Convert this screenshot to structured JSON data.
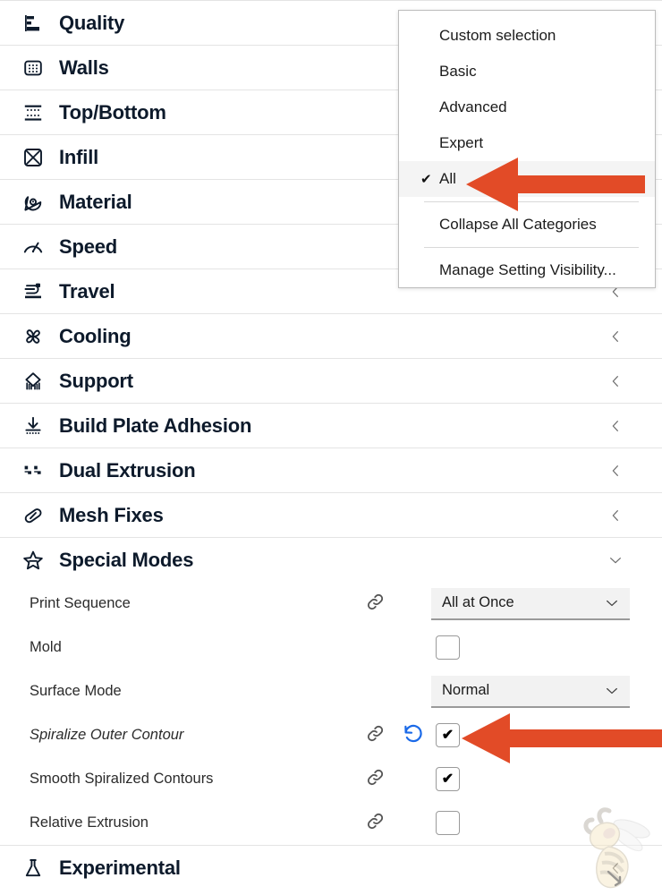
{
  "categories": [
    {
      "label": "Quality",
      "icon": "quality-icon",
      "expanded": false
    },
    {
      "label": "Walls",
      "icon": "walls-icon",
      "expanded": false
    },
    {
      "label": "Top/Bottom",
      "icon": "top-bottom-icon",
      "expanded": false
    },
    {
      "label": "Infill",
      "icon": "infill-icon",
      "expanded": false
    },
    {
      "label": "Material",
      "icon": "material-icon",
      "expanded": false
    },
    {
      "label": "Speed",
      "icon": "speed-icon",
      "expanded": false
    },
    {
      "label": "Travel",
      "icon": "travel-icon",
      "expanded": false
    },
    {
      "label": "Cooling",
      "icon": "cooling-icon",
      "expanded": false
    },
    {
      "label": "Support",
      "icon": "support-icon",
      "expanded": false
    },
    {
      "label": "Build Plate Adhesion",
      "icon": "adhesion-icon",
      "expanded": false
    },
    {
      "label": "Dual Extrusion",
      "icon": "dual-extrusion-icon",
      "expanded": false
    },
    {
      "label": "Mesh Fixes",
      "icon": "mesh-fixes-icon",
      "expanded": false
    },
    {
      "label": "Special Modes",
      "icon": "special-modes-icon",
      "expanded": true
    },
    {
      "label": "Experimental",
      "icon": "experimental-icon",
      "expanded": false
    }
  ],
  "settings": [
    {
      "label": "Print Sequence",
      "italic": false,
      "link": true,
      "revert": false,
      "control": "combo",
      "value": "All at Once"
    },
    {
      "label": "Mold",
      "italic": false,
      "link": false,
      "revert": false,
      "control": "checkbox",
      "checked": false
    },
    {
      "label": "Surface Mode",
      "italic": false,
      "link": false,
      "revert": false,
      "control": "combo",
      "value": "Normal"
    },
    {
      "label": "Spiralize Outer Contour",
      "italic": true,
      "link": true,
      "revert": true,
      "control": "checkbox",
      "checked": true
    },
    {
      "label": "Smooth Spiralized Contours",
      "italic": false,
      "link": true,
      "revert": false,
      "control": "checkbox",
      "checked": true
    },
    {
      "label": "Relative Extrusion",
      "italic": false,
      "link": true,
      "revert": false,
      "control": "checkbox",
      "checked": false
    }
  ],
  "menu": {
    "items": [
      {
        "label": "Custom selection",
        "checked": false,
        "selected": false,
        "sep_after": false
      },
      {
        "label": "Basic",
        "checked": false,
        "selected": false,
        "sep_after": false
      },
      {
        "label": "Advanced",
        "checked": false,
        "selected": false,
        "sep_after": false
      },
      {
        "label": "Expert",
        "checked": false,
        "selected": false,
        "sep_after": false
      },
      {
        "label": "All",
        "checked": true,
        "selected": true,
        "sep_after": true
      },
      {
        "label": "Collapse All Categories",
        "checked": false,
        "selected": false,
        "sep_after": true
      },
      {
        "label": "Manage Setting Visibility...",
        "checked": false,
        "selected": false,
        "sep_after": false
      }
    ],
    "check_glyph": "✔"
  },
  "glyphs": {
    "chevron_left": "‹",
    "chevron_down": "⌄",
    "tick": "✔"
  },
  "colors": {
    "accent_arrow": "#E24B27",
    "revert_blue": "#1B6AE8",
    "text": "#1B1B1B",
    "header_text": "#0D1A2B",
    "combo_bg": "#F2F2F2",
    "selected_row_bg": "#F4F4F4",
    "divider": "#E4E4E4"
  },
  "watermark": {
    "name": "bee-mascot"
  }
}
